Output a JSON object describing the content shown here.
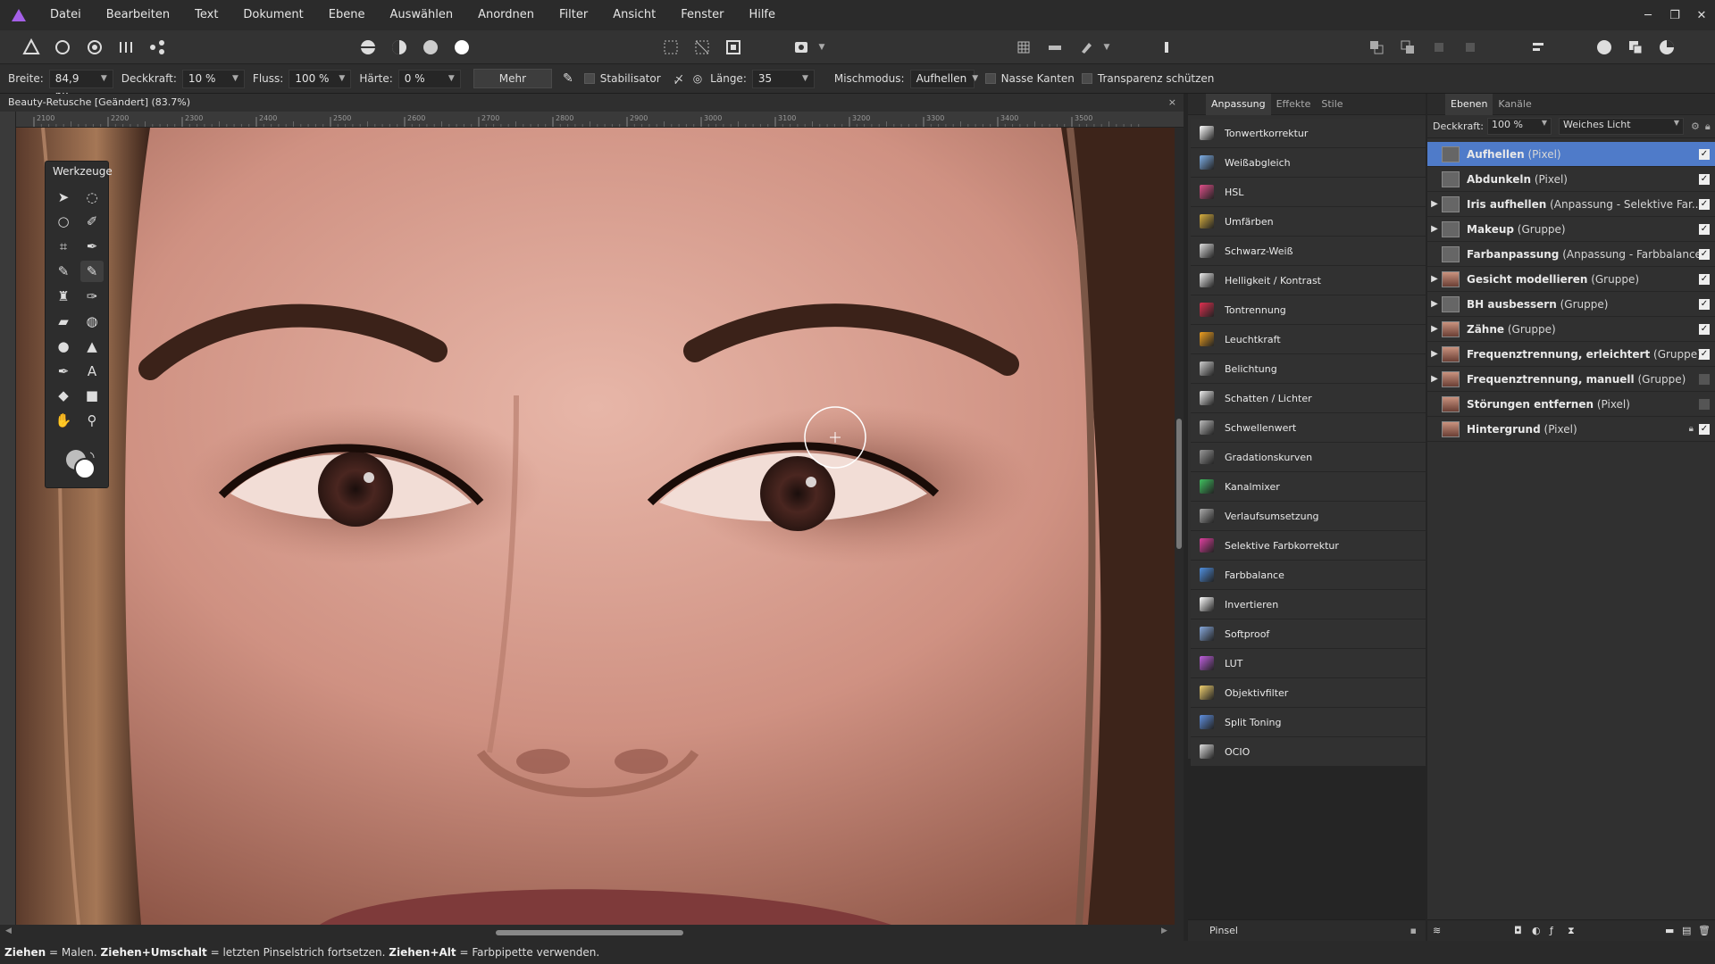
{
  "menu": [
    "Datei",
    "Bearbeiten",
    "Text",
    "Dokument",
    "Ebene",
    "Auswählen",
    "Anordnen",
    "Filter",
    "Ansicht",
    "Fenster",
    "Hilfe"
  ],
  "context": {
    "breite_label": "Breite:",
    "breite_value": "84,9 px",
    "deckkraft_label": "Deckkraft:",
    "deckkraft_value": "10 %",
    "fluss_label": "Fluss:",
    "fluss_value": "100 %",
    "haerte_label": "Härte:",
    "haerte_value": "0 %",
    "mehr_label": "Mehr",
    "stabilisator_label": "Stabilisator",
    "laenge_label": "Länge:",
    "laenge_value": "35",
    "mischmodus_label": "Mischmodus:",
    "mischmodus_value": "Aufhellen",
    "nasse_kanten_label": "Nasse Kanten",
    "transparenz_label": "Transparenz schützen"
  },
  "document": {
    "tab_title": "Beauty-Retusche [Geändert] (83.7%)",
    "close_glyph": "×"
  },
  "ruler_ticks": [
    "2100",
    "2200",
    "2300",
    "2400",
    "2500",
    "2600",
    "2700",
    "2800",
    "2900",
    "3000",
    "3100",
    "3200",
    "3300",
    "3400",
    "3500"
  ],
  "tools_panel": {
    "title": "Werkzeuge"
  },
  "adjust_panel": {
    "tabs": [
      "Anpassung",
      "Effekte",
      "Stile"
    ],
    "items": [
      {
        "label": "Tonwertkorrektur",
        "color": "#ffffff"
      },
      {
        "label": "Weißabgleich",
        "color": "#7fb0e8"
      },
      {
        "label": "HSL",
        "color": "#e0508a"
      },
      {
        "label": "Umfärben",
        "color": "#d8b040"
      },
      {
        "label": "Schwarz-Weiß",
        "color": "#dddddd"
      },
      {
        "label": "Helligkeit / Kontrast",
        "color": "#eeeeee"
      },
      {
        "label": "Tontrennung",
        "color": "#e03050"
      },
      {
        "label": "Leuchtkraft",
        "color": "#f0a020"
      },
      {
        "label": "Belichtung",
        "color": "#cccccc"
      },
      {
        "label": "Schatten / Lichter",
        "color": "#eeeeee"
      },
      {
        "label": "Schwellenwert",
        "color": "#bbbbbb"
      },
      {
        "label": "Gradationskurven",
        "color": "#999999"
      },
      {
        "label": "Kanalmixer",
        "color": "#40c060"
      },
      {
        "label": "Verlaufsumsetzung",
        "color": "#aaaaaa"
      },
      {
        "label": "Selektive Farbkorrektur",
        "color": "#e040a0"
      },
      {
        "label": "Farbbalance",
        "color": "#5090e0"
      },
      {
        "label": "Invertieren",
        "color": "#ffffff"
      },
      {
        "label": "Softproof",
        "color": "#88aadd"
      },
      {
        "label": "LUT",
        "color": "#c060e0"
      },
      {
        "label": "Objektivfilter",
        "color": "#f0d070"
      },
      {
        "label": "Split Toning",
        "color": "#6090e0"
      },
      {
        "label": "OCIO",
        "color": "#dddddd"
      }
    ],
    "footer": "Pinsel"
  },
  "layers_panel": {
    "tabs": [
      "Ebenen",
      "Kanäle"
    ],
    "opacity_label": "Deckkraft:",
    "opacity_value": "100 %",
    "blend_value": "Weiches Licht",
    "layers": [
      {
        "name": "Aufhellen",
        "type": "(Pixel)",
        "arrow": "",
        "visible": true,
        "selected": true,
        "face": false
      },
      {
        "name": "Abdunkeln",
        "type": "(Pixel)",
        "arrow": "",
        "visible": true,
        "selected": false,
        "face": false
      },
      {
        "name": "Iris aufhellen",
        "type": "(Anpassung - Selektive Far...",
        "arrow": "▶",
        "visible": true,
        "selected": false,
        "face": false
      },
      {
        "name": "Makeup",
        "type": "(Gruppe)",
        "arrow": "▶",
        "visible": true,
        "selected": false,
        "face": false
      },
      {
        "name": "Farbanpassung",
        "type": "(Anpassung - Farbbalance)",
        "arrow": "",
        "visible": true,
        "selected": false,
        "face": false
      },
      {
        "name": "Gesicht modellieren",
        "type": "(Gruppe)",
        "arrow": "▶",
        "visible": true,
        "selected": false,
        "face": true
      },
      {
        "name": "BH ausbessern",
        "type": "(Gruppe)",
        "arrow": "▶",
        "visible": true,
        "selected": false,
        "face": false
      },
      {
        "name": "Zähne",
        "type": "(Gruppe)",
        "arrow": "▶",
        "visible": true,
        "selected": false,
        "face": true
      },
      {
        "name": "Frequenztrennung, erleichtert",
        "type": "(Gruppe)",
        "arrow": "▶",
        "visible": true,
        "selected": false,
        "face": true
      },
      {
        "name": "Frequenztrennung, manuell",
        "type": "(Gruppe)",
        "arrow": "▶",
        "visible": false,
        "selected": false,
        "face": true
      },
      {
        "name": "Störungen entfernen",
        "type": "(Pixel)",
        "arrow": "",
        "visible": false,
        "selected": false,
        "face": true
      },
      {
        "name": "Hintergrund",
        "type": "(Pixel)",
        "arrow": "",
        "visible": true,
        "selected": false,
        "face": true,
        "locked": true
      }
    ]
  },
  "status": {
    "k1": "Ziehen",
    "t1": " = Malen. ",
    "k2": "Ziehen+Umschalt",
    "t2": " = letzten Pinselstrich fortsetzen. ",
    "k3": "Ziehen+Alt",
    "t3": " = Farbpipette verwenden."
  }
}
